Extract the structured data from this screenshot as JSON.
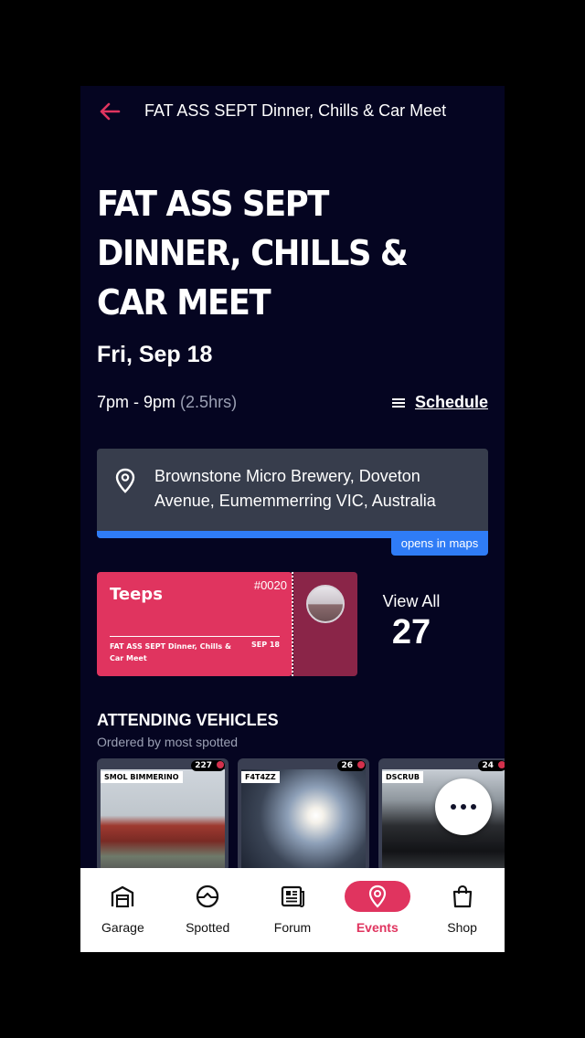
{
  "header": {
    "title": "FAT ASS SEPT Dinner, Chills & Car Meet"
  },
  "event": {
    "title": "FAT ASS SEPT DINNER, CHILLS & CAR MEET",
    "date": "Fri, Sep 18",
    "time": "7pm - 9pm",
    "duration": "(2.5hrs)",
    "schedule_label": "Schedule"
  },
  "location": {
    "address": "Brownstone Micro Brewery, Doveton Avenue, Eumemmerring VIC, Australia",
    "maps_label": "opens in maps"
  },
  "ticket": {
    "name": "Teeps",
    "number": "#0020",
    "event_name": "FAT ASS SEPT Dinner, Chills & Car Meet",
    "date": "SEP 18"
  },
  "attendees": {
    "view_all_label": "View All",
    "count": "27"
  },
  "vehicles": {
    "title": "ATTENDING VEHICLES",
    "subtitle": "Ordered by most spotted",
    "cards": [
      {
        "name": "SMOL BIMMERINO",
        "spotted": "227"
      },
      {
        "name": "F4T4ZZ",
        "spotted": "26"
      },
      {
        "name": "DSCRUB",
        "spotted": "24"
      }
    ]
  },
  "tabs": [
    {
      "label": "Garage",
      "icon": "garage-icon"
    },
    {
      "label": "Spotted",
      "icon": "spotted-icon"
    },
    {
      "label": "Forum",
      "icon": "forum-icon"
    },
    {
      "label": "Events",
      "icon": "events-icon",
      "active": true
    },
    {
      "label": "Shop",
      "icon": "shop-icon"
    }
  ],
  "colors": {
    "accent": "#e0345f",
    "background": "#050521",
    "map_blue": "#2f7cf6"
  }
}
